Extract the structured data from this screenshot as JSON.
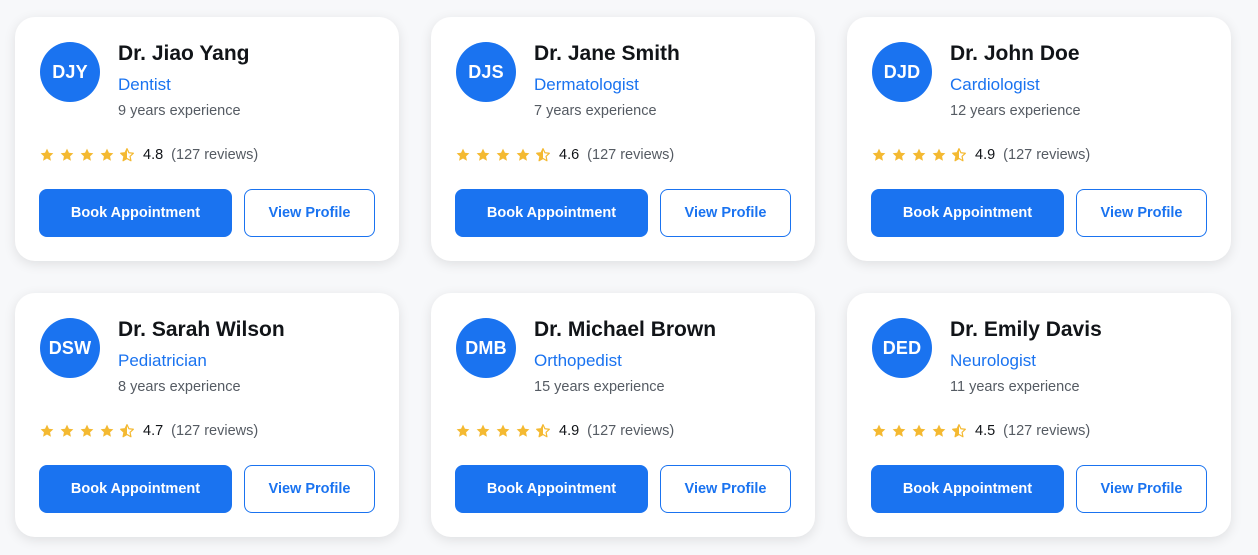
{
  "colors": {
    "accent": "#1a73f0",
    "star": "#f4b931",
    "background": "#f7f8fa"
  },
  "icons": {
    "full_star": "star-icon",
    "half_star": "star-half-icon"
  },
  "doctors": [
    {
      "initials": "DJY",
      "name": "Dr. Jiao Yang",
      "specialty": "Dentist",
      "experience": "9 years experience",
      "rating": "4.8",
      "reviews": "(127 reviews)",
      "book_label": "Book Appointment",
      "view_label": "View Profile"
    },
    {
      "initials": "DJS",
      "name": "Dr. Jane Smith",
      "specialty": "Dermatologist",
      "experience": "7 years experience",
      "rating": "4.6",
      "reviews": "(127 reviews)",
      "book_label": "Book Appointment",
      "view_label": "View Profile"
    },
    {
      "initials": "DJD",
      "name": "Dr. John Doe",
      "specialty": "Cardiologist",
      "experience": "12 years experience",
      "rating": "4.9",
      "reviews": "(127 reviews)",
      "book_label": "Book Appointment",
      "view_label": "View Profile"
    },
    {
      "initials": "DSW",
      "name": "Dr. Sarah Wilson",
      "specialty": "Pediatrician",
      "experience": "8 years experience",
      "rating": "4.7",
      "reviews": "(127 reviews)",
      "book_label": "Book Appointment",
      "view_label": "View Profile"
    },
    {
      "initials": "DMB",
      "name": "Dr. Michael Brown",
      "specialty": "Orthopedist",
      "experience": "15 years experience",
      "rating": "4.9",
      "reviews": "(127 reviews)",
      "book_label": "Book Appointment",
      "view_label": "View Profile"
    },
    {
      "initials": "DED",
      "name": "Dr. Emily Davis",
      "specialty": "Neurologist",
      "experience": "11 years experience",
      "rating": "4.5",
      "reviews": "(127 reviews)",
      "book_label": "Book Appointment",
      "view_label": "View Profile"
    }
  ]
}
